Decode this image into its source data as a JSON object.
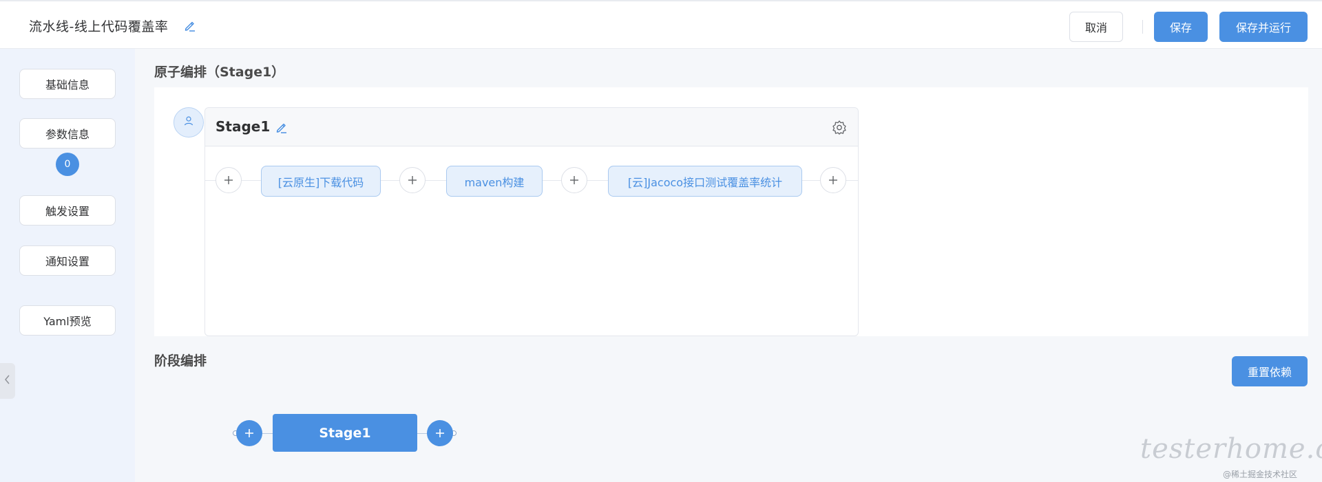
{
  "header": {
    "title": "流水线-线上代码覆盖率",
    "cancel_label": "取消",
    "save_label": "保存",
    "save_run_label": "保存并运行"
  },
  "sidebar": {
    "items": [
      {
        "label": "基础信息"
      },
      {
        "label": "参数信息"
      },
      {
        "label": "触发设置"
      },
      {
        "label": "通知设置"
      },
      {
        "label": "Yaml预览"
      }
    ],
    "param_badge": "0"
  },
  "atom_section": {
    "title": "原子编排（Stage1）",
    "stage_name": "Stage1",
    "steps": [
      {
        "label": "[云原生]下载代码"
      },
      {
        "label": "maven构建"
      },
      {
        "label": "[云]Jacoco接口测试覆盖率统计"
      }
    ]
  },
  "stage_section": {
    "title": "阶段编排",
    "reset_label": "重置依赖",
    "stages": [
      {
        "label": "Stage1"
      }
    ]
  },
  "watermark": {
    "logo_text": "testerhome.com",
    "sub_text": "@稀土掘金技术社区"
  },
  "colors": {
    "primary": "#4a90e2",
    "sidebar_bg": "#eef3fc",
    "step_bg": "#e6f0fc"
  },
  "icons": {
    "edit": "pencil-icon",
    "settings": "gear-icon",
    "add": "plus-icon",
    "stage_avatar": "user-icon",
    "collapse": "chevron-left-icon"
  }
}
